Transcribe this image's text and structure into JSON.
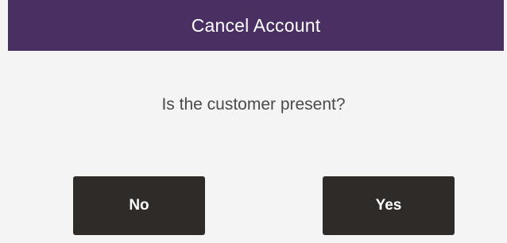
{
  "dialog": {
    "title": "Cancel Account",
    "message": "Is the customer present?",
    "buttons": {
      "no_label": "No",
      "yes_label": "Yes"
    }
  },
  "colors": {
    "title_bar": "#4a2f63",
    "button_bg": "#2f2b29",
    "dialog_bg": "#f5f4f4"
  }
}
